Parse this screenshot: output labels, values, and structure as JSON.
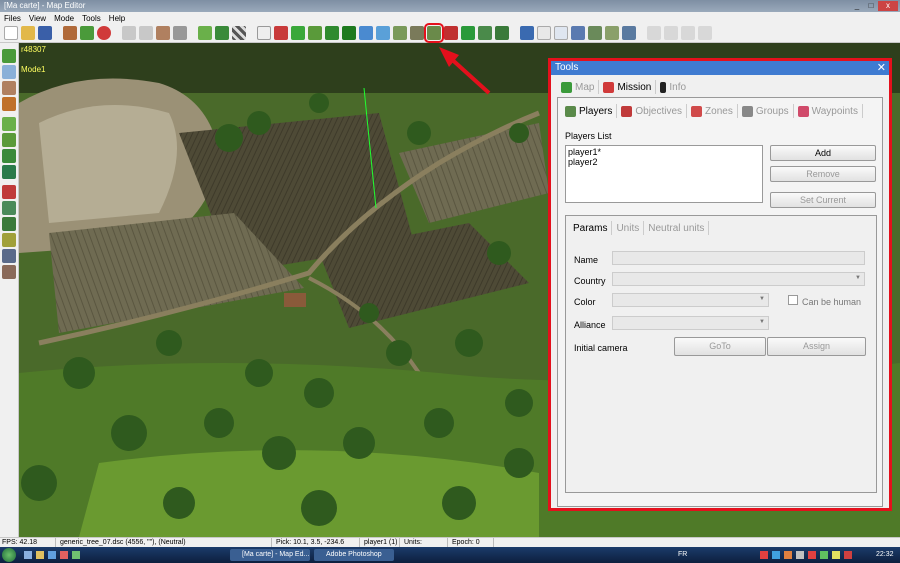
{
  "window": {
    "title": "[Ma carte] - Map Editor"
  },
  "menu": [
    "Files",
    "View",
    "Mode",
    "Tools",
    "Help"
  ],
  "viewport": {
    "build": "r48307",
    "mode": "Mode1"
  },
  "tools_panel": {
    "title": "Tools",
    "close": "✕",
    "top_tabs": [
      {
        "label": "Map",
        "active": false
      },
      {
        "label": "Mission",
        "active": true
      },
      {
        "label": "Info",
        "active": false
      }
    ],
    "sub_tabs": [
      {
        "label": "Players",
        "active": true
      },
      {
        "label": "Objectives",
        "active": false
      },
      {
        "label": "Zones",
        "active": false
      },
      {
        "label": "Groups",
        "active": false
      },
      {
        "label": "Waypoints",
        "active": false
      }
    ],
    "players_list_label": "Players List",
    "players": [
      "player1*",
      "player2"
    ],
    "buttons": {
      "add": "Add",
      "remove": "Remove",
      "set_current": "Set Current"
    },
    "params_tabs": [
      {
        "label": "Params",
        "active": true
      },
      {
        "label": "Units",
        "active": false
      },
      {
        "label": "Neutral units",
        "active": false
      }
    ],
    "fields": {
      "name": "Name",
      "country": "Country",
      "color": "Color",
      "can_be_human": "Can be human",
      "alliance": "Alliance",
      "initial_camera": "Initial camera",
      "goto": "GoTo",
      "assign": "Assign"
    }
  },
  "status_bar": {
    "fps": "FPS: 42.18",
    "object": "generic_tree_07.dsc (4556, \"\"), (Neutral)",
    "pick": "Pick: 10.1, 3.5, -234.6",
    "player": "player1 (1)",
    "units": "Units:",
    "epoch": "Epoch: 0"
  },
  "taskbar": {
    "items": [
      "[Ma carte] - Map Ed...",
      "Adobe Photoshop"
    ],
    "lang": "FR",
    "clock": "22:32"
  },
  "colors": {
    "highlight": "#e4101c",
    "title_blue": "#3f7bd1"
  }
}
